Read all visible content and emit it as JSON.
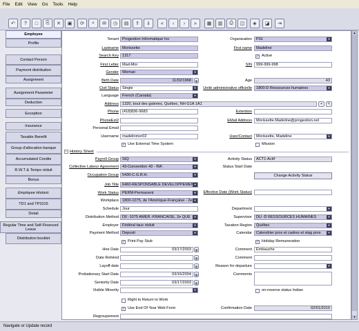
{
  "menu": [
    "File",
    "Edit",
    "View",
    "Go",
    "Tools",
    "Help"
  ],
  "sidebar": [
    "Employee",
    "Profile",
    "Contact Person",
    "Payment distribution",
    "Assignment",
    "Assignment Parameter",
    "Deduction",
    "Exception",
    "Insurance",
    "Taxable Benefit",
    "Group d'allocation banque",
    "Accumulated Credits",
    "R.W.T & Temps réduit",
    "Bonus",
    "Employee Historic",
    "TD1 and TP1015",
    "Detail",
    "Regular Time and Self-Financed Leave",
    "Distribution booklet"
  ],
  "f": {
    "tenant_l": "Tenant",
    "tenant": "Progestion Informatique Inc",
    "org_l": "Organization",
    "org": "PGI",
    "last_l": "Lastname",
    "last": "Morissette",
    "first_l": "First name",
    "first": "Madeline",
    "search_l": "Search Key",
    "search": "1317",
    "active_l": "Active",
    "fl_l": "First Letter",
    "fl": "Mad-Mor",
    "sin_l": "SIN",
    "sin": "999-999-998",
    "gender_l": "Gender",
    "gender": "Woman",
    "birth_l": "Birth Date",
    "birth": "11/02/1968",
    "age_l": "Age",
    "age": "43",
    "civil_l": "Civil Status",
    "civil": "Single",
    "unit_l": "Unité administrative officielle",
    "unit": "1800-D Ressources humaines",
    "lang_l": "Language",
    "lang": "French (Canada)",
    "addr_l": "Address",
    "addr": "1320, boul des galeries, Québec, NH G1A 1A1",
    "phone_l": "Phone",
    "phone": "(418)836-9683",
    "ext_l": "Extention",
    "phone2_l": "PhoneExt2",
    "email_l": "EMail Address",
    "email": "Morissette.Madeline@progestion.net",
    "pemail_l": "Personal Email",
    "user_l": "Username",
    "user": "madelinmor02",
    "uc_l": "User/Contact",
    "uc": "Morissette, Madeline",
    "ext_sys_l": "Use External Time System",
    "mission_l": "Mission"
  },
  "h": {
    "section": "History Sheet",
    "pg_l": "Payroll Group",
    "pg": "SIQ",
    "as_l": "Activity Status",
    "as": "ACT1-Actif",
    "cla_l": "Collective Labour Agreement",
    "cla": "43-Convention 43 - INF.",
    "ssd_l": "Status Start Date",
    "og_l": "Occupation Group",
    "og": "5430-C.G.R.H.",
    "cas_btn": "Change Activity Status",
    "jt_l": "Job Title",
    "jt": "6460-RESPONSABLE DEVELOPPEMEN",
    "ed_l": "Effective Date (Work Status)",
    "ws_l": "Work Status",
    "ws": "PERM-Permanent",
    "wp_l": "Workplace",
    "wp": "1800-1075, de l'Amérique-Française - 2e",
    "sch_l": "Schedule",
    "sch": "Jour",
    "dept_l": "Department",
    "dm_l": "Distribution Method",
    "dm": "D0 -1075 AMER.-FRANCAISE, 2e QUE",
    "sup_l": "Supervisor",
    "sup": "DU -D RESSOURCES HUMAINES",
    "emp_l": "Employer",
    "emp": "Fédéral taux réduit",
    "tr_l": "Taxation Region",
    "tr": "Québec",
    "pm_l": "Payment Method",
    "pm": "Deposit",
    "cal_l": "Calendar",
    "cal": "Calendrier pros et cadres et stag pros",
    "pps_l": "Print Pay Stub",
    "hr_l": "Holiday Remuneration",
    "hire_l": "Hire Date",
    "hire": "03/17/2003",
    "com1_l": "Comment",
    "com1": "Embauche",
    "reh_l": "Date Rehired",
    "com2_l": "Comment",
    "lay_l": "Layoff date",
    "rfd_l": "Reason for departure",
    "prob_l": "Probationary Start Date",
    "prob": "03/16/2004",
    "coms_l": "Comments",
    "sen_l": "Seniority Date",
    "sen": "03/17/2003",
    "vm_l": "Visible Minority",
    "ors_l": "on-reserve status Indian",
    "rrw_l": "Right to Return to Work",
    "eyw_l": "Use End Of Year Web Form",
    "cd_l": "Confirmation Date",
    "cd": "02/01/2010",
    "reg_l": "Regroupement"
  },
  "status": "Navigate or Update record"
}
